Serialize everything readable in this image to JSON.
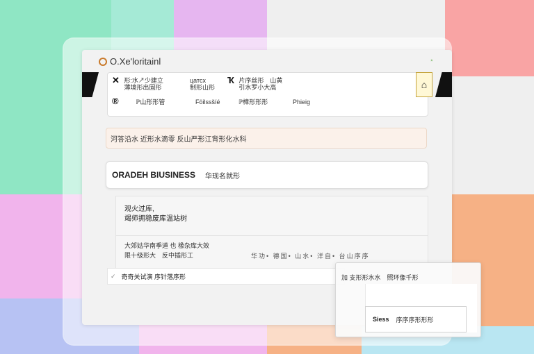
{
  "window": {
    "title": "O.Xe'loritainl",
    "corner_icon": "⋆"
  },
  "toolbar": {
    "items": [
      {
        "icon": "✕",
        "line1": "形:水↗少建立",
        "line2": "薄境形出固形"
      },
      {
        "label": "цатсх",
        "line2": "制形山形"
      },
      {
        "icon": "Ҡ",
        "line1": "片序丝形　山黄",
        "line2": "引水罗小大高"
      },
      {
        "icon": "®",
        "line1": "ℙ山形形管"
      },
      {
        "label": "Föilssšíé"
      },
      {
        "line1": "ℙ樟形形形"
      },
      {
        "label": "Phieig"
      }
    ]
  },
  "alert": {
    "text": "河答沿水 近形水滴零 反山严形江背形化水科"
  },
  "search": {
    "label": "ORADEH BIUSINESS",
    "value": "华现名就形"
  },
  "panel": {
    "heading_line1": "观火过库,",
    "heading_line2": "竭师拥稳废库温站树",
    "text_line1": "大郊姑华南季道 也 橡杂库大效",
    "text_line2": "限十级形大　反中插形工",
    "cells": "华功• 德国• 山水• 洋自• 台山序序"
  },
  "dropdown": {
    "text": "奇奇关试演 序针落序形"
  },
  "float_panel": {
    "row_text": "加 支形形水水　照环像千形",
    "key": "Siess",
    "value": "序序序形形形"
  }
}
